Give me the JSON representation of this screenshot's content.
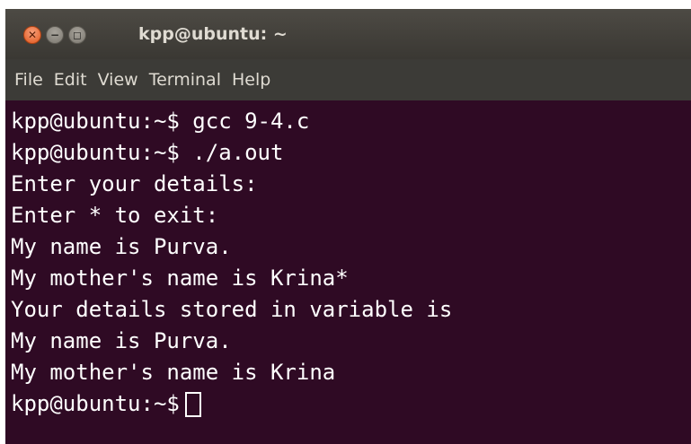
{
  "window": {
    "title": "kpp@ubuntu: ~",
    "buttons": {
      "close_glyph": "✕",
      "minimize_glyph": "−",
      "maximize_glyph": "◻"
    }
  },
  "menubar": {
    "items": [
      "File",
      "Edit",
      "View",
      "Terminal",
      "Help"
    ]
  },
  "terminal": {
    "lines": [
      "kpp@ubuntu:~$ gcc 9-4.c",
      "kpp@ubuntu:~$ ./a.out",
      "Enter your details:",
      "Enter * to exit:",
      "My name is Purva.",
      "My mother's name is Krina*",
      "Your details stored in variable is",
      "My name is Purva.",
      "My mother's name is Krina"
    ],
    "prompt": "kpp@ubuntu:~$"
  },
  "colors": {
    "terminal_background": "#2f0a24",
    "terminal_text": "#ffffff",
    "close_button": "#e2571c",
    "titlebar": "#3c3b37"
  }
}
